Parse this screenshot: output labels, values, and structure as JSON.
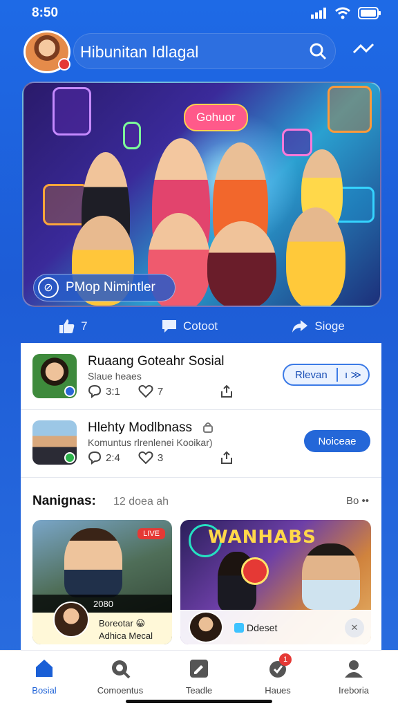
{
  "status": {
    "time": "8:50"
  },
  "header": {
    "title": "Hibunitan Idlagal"
  },
  "hero": {
    "pill": "Gohuor",
    "badge": "PMop Nimintler"
  },
  "actions": {
    "like_count": "7",
    "comment_label": "Cotoot",
    "share_label": "Sioge"
  },
  "posts": [
    {
      "title": "Ruaang Goteahr Sosial",
      "subtitle": "Slaue heaes",
      "comments": "3:1",
      "likes": "7",
      "button": "Rlevan",
      "button_extra": "ı ≫"
    },
    {
      "title": "Hlehty Modlbnass",
      "subtitle": "Komuntus rlrenlenei Kooikar)",
      "comments": "2:4",
      "likes": "3",
      "button": "Noiceae"
    }
  ],
  "section": {
    "title": "Nanignas:",
    "subtitle": "12 doea ah",
    "more": "Bo ••"
  },
  "cards": [
    {
      "live": "LIVE",
      "bar": "2080",
      "line1": "Boreotar 😀",
      "line2": "Adhica Mecal"
    },
    {
      "brand": "WANHABS",
      "chip": "Ddeset",
      "close": "✕"
    }
  ],
  "tabs": [
    {
      "label": "Bosial"
    },
    {
      "label": "Comoentus"
    },
    {
      "label": "Teadle"
    },
    {
      "label": "Haues",
      "badge": "1"
    },
    {
      "label": "Ireboria"
    }
  ],
  "colors": {
    "primary": "#1d5cd6",
    "accent": "#2467d8",
    "notification": "#e53935"
  }
}
